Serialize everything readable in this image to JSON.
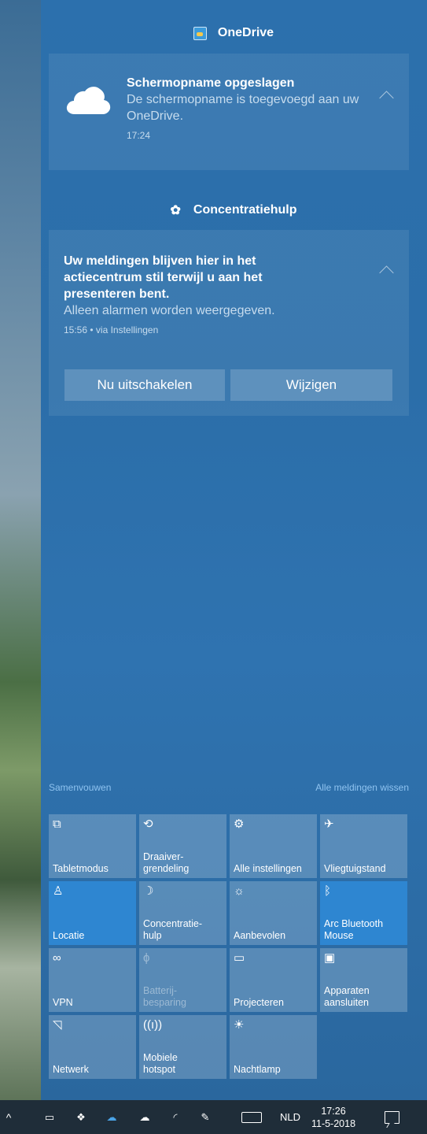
{
  "onedrive": {
    "header": "OneDrive",
    "title": "Schermopname opgeslagen",
    "body": "De schermopname is toegevoegd aan uw OneDrive.",
    "time": "17:24"
  },
  "focus": {
    "header": "Concentratiehulp",
    "title": "Uw meldingen blijven hier in het actiecentrum stil terwijl u aan het presenteren bent.",
    "body": "Alleen alarmen worden weergegeven.",
    "time": "15:56 • via Instellingen",
    "btn_off": "Nu uitschakelen",
    "btn_change": "Wijzigen"
  },
  "links": {
    "collapse": "Samenvouwen",
    "clear_all": "Alle meldingen wissen"
  },
  "tiles": [
    {
      "label": "Tabletmodus",
      "icon": "tablet-mode-icon",
      "glyph": "⧉"
    },
    {
      "label": "Draaiver-\ngrendeling",
      "icon": "rotation-lock-icon",
      "glyph": "⟲"
    },
    {
      "label": "Alle instellingen",
      "icon": "settings-icon",
      "glyph": "⚙"
    },
    {
      "label": "Vliegtuigstand",
      "icon": "airplane-icon",
      "glyph": "✈"
    },
    {
      "label": "Locatie",
      "icon": "location-icon",
      "glyph": "♙"
    },
    {
      "label": "Concentratie-\nhulp",
      "icon": "moon-icon",
      "glyph": "☽"
    },
    {
      "label": "Aanbevolen",
      "icon": "brightness-icon",
      "glyph": "☼"
    },
    {
      "label": "Arc Bluetooth\nMouse",
      "icon": "bluetooth-icon",
      "glyph": "ᛒ"
    },
    {
      "label": "VPN",
      "icon": "vpn-icon",
      "glyph": "∞"
    },
    {
      "label": "Batterij-\nbesparing",
      "icon": "battery-saver-icon",
      "glyph": "ϕ"
    },
    {
      "label": "Projecteren",
      "icon": "project-icon",
      "glyph": "▭"
    },
    {
      "label": "Apparaten\naansluiten",
      "icon": "connect-devices-icon",
      "glyph": "▣"
    },
    {
      "label": "Netwerk",
      "icon": "network-icon",
      "glyph": "◹"
    },
    {
      "label": "Mobiele\nhotspot",
      "icon": "hotspot-icon",
      "glyph": "((ı))"
    },
    {
      "label": "Nachtlamp",
      "icon": "night-light-icon",
      "glyph": "☀"
    }
  ],
  "taskbar": {
    "language": "NLD",
    "time": "17:26",
    "date": "11-5-2018"
  }
}
